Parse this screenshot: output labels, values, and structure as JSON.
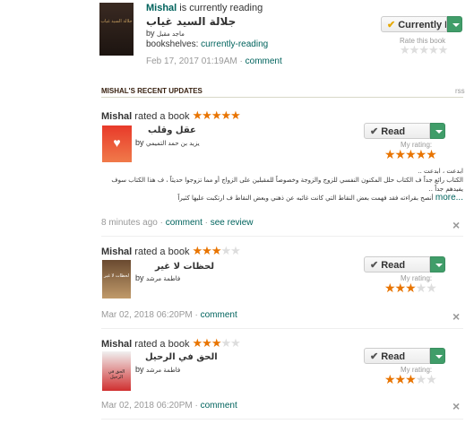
{
  "current": {
    "user": "Mishal",
    "status": "is currently reading",
    "book_title": "جلالة السيد غياب",
    "by_label": "by",
    "author": "ماجد مقبل",
    "bookshelves_label": "bookshelves:",
    "shelf": "currently-reading",
    "timestamp": "Feb 17, 2017 01:19AM",
    "comment": "comment",
    "button_label": "Currently Re...",
    "rate_label": "Rate this book",
    "cover_text": "جلالة السيد غياب",
    "rating": 0
  },
  "section": {
    "title": "MISHAL'S RECENT UPDATES",
    "rss": "rss"
  },
  "updates": [
    {
      "user": "Mishal",
      "action": "rated a book",
      "rating": 5,
      "book_title": "عقل وقلب",
      "by_label": "by",
      "author": "يزيد بن حمد التميمي",
      "review_line1": "ابدعت ، ابدعت ..",
      "review_line2": "الكتاب رائع جداً ف الكتاب حلل المكنون النفسي للزوج والزوجة وخصوصاً للمقبلين على الزواج أو مما تزوجوا حديثاً ، ف هذا الكتاب سوف",
      "review_line3": "يفيدهم جداً ..",
      "review_more": "...more",
      "review_line4": "أنصح بقراءته فقد فهمت بعض النقاط التي كانت غائبه عن ذهني وبعض النقاط ف ارتكبت عليها كثيراً",
      "timestamp": "8 minutes ago",
      "comment": "comment",
      "see_review": "see review",
      "button_label": "Read",
      "my_rating_label": "My rating:"
    },
    {
      "user": "Mishal",
      "action": "rated a book",
      "rating": 3,
      "book_title": "لحظات لا غير",
      "by_label": "by",
      "author": "فاطمة مرشد",
      "cover_text": "لحظات لا غير",
      "timestamp": "Mar 02, 2018 06:20PM",
      "comment": "comment",
      "button_label": "Read",
      "my_rating_label": "My rating:"
    },
    {
      "user": "Mishal",
      "action": "rated a book",
      "rating": 3,
      "book_title": "الحق في الرحيل",
      "by_label": "by",
      "author": "فاطمة مرشد",
      "cover_text": "الحق في الرحيل",
      "timestamp": "Mar 02, 2018 06:20PM",
      "comment": "comment",
      "button_label": "Read",
      "my_rating_label": "My rating:"
    }
  ],
  "icons": {
    "check": "check-icon",
    "dropdown": "chevron-down-icon",
    "close": "close-icon",
    "star": "star-icon"
  },
  "colors": {
    "link": "#00635d",
    "star": "#e87400",
    "button_green": "#409d69"
  }
}
